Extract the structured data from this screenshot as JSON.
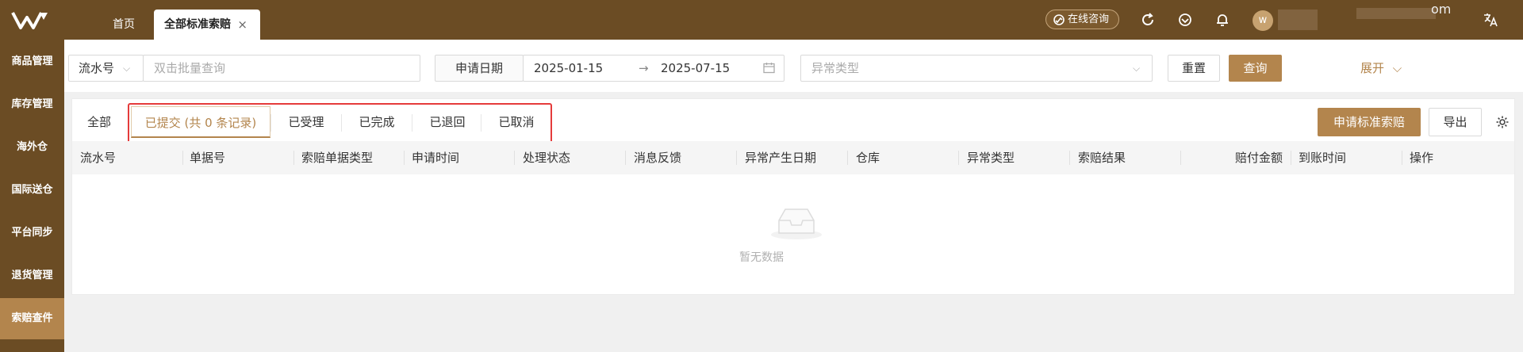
{
  "topbar": {
    "tabs": [
      {
        "label": "首页"
      },
      {
        "label": "全部标准索赔",
        "close": "×"
      }
    ],
    "consult_label": "在线咨询",
    "avatar_letter": "w",
    "user_tail": "om"
  },
  "sidebar": {
    "items": [
      {
        "label": "商品管理"
      },
      {
        "label": "库存管理"
      },
      {
        "label": "海外仓"
      },
      {
        "label": "国际送仓"
      },
      {
        "label": "平台同步"
      },
      {
        "label": "退货管理"
      },
      {
        "label": "索赔查件",
        "active": true
      }
    ]
  },
  "filters": {
    "serial_select": "流水号",
    "batch_placeholder": "双击批量查询",
    "date_label": "申请日期",
    "date_start": "2025-01-15",
    "date_arrow": "→",
    "date_end": "2025-07-15",
    "exception_placeholder": "异常类型",
    "reset_label": "重置",
    "query_label": "查询",
    "expand_label": "展开"
  },
  "status_tabs": [
    {
      "label": "全部"
    },
    {
      "label": "已提交 (共 0 条记录)",
      "active": true
    },
    {
      "label": "已受理"
    },
    {
      "label": "已完成"
    },
    {
      "label": "已退回"
    },
    {
      "label": "已取消"
    }
  ],
  "actions": {
    "apply_label": "申请标准索赔",
    "export_label": "导出"
  },
  "table": {
    "columns": [
      "流水号",
      "单据号",
      "索赔单据类型",
      "申请时间",
      "处理状态",
      "消息反馈",
      "异常产生日期",
      "仓库",
      "异常类型",
      "索赔结果",
      "赔付金额",
      "到账时间",
      "操作"
    ],
    "empty_text": "暂无数据"
  },
  "colors": {
    "brand_dark": "#6b4c24",
    "brand_accent": "#b3854d",
    "highlight_red": "#e53b3b"
  }
}
